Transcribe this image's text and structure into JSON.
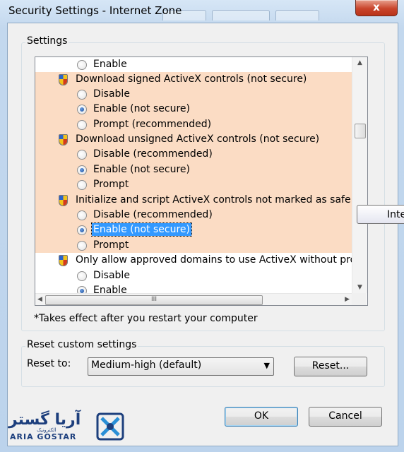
{
  "window": {
    "title": "Security Settings - Internet Zone",
    "close_glyph": "x"
  },
  "settings_group": {
    "label": "Settings",
    "items": [
      {
        "kind": "option",
        "label": "Enable",
        "checked": false
      },
      {
        "kind": "header",
        "label": "Download signed ActiveX controls (not secure)",
        "icon": "security-shield-icon"
      },
      {
        "kind": "option",
        "label": "Disable",
        "checked": false
      },
      {
        "kind": "option",
        "label": "Enable (not secure)",
        "checked": true
      },
      {
        "kind": "option",
        "label": "Prompt (recommended)",
        "checked": false
      },
      {
        "kind": "header",
        "label": "Download unsigned ActiveX controls (not secure)",
        "icon": "security-shield-icon"
      },
      {
        "kind": "option",
        "label": "Disable (recommended)",
        "checked": false
      },
      {
        "kind": "option",
        "label": "Enable (not secure)",
        "checked": true
      },
      {
        "kind": "option",
        "label": "Prompt",
        "checked": false
      },
      {
        "kind": "header",
        "label": "Initialize and script ActiveX controls not marked as safe for sc",
        "icon": "security-shield-icon"
      },
      {
        "kind": "option",
        "label": "Disable (recommended)",
        "checked": false
      },
      {
        "kind": "option",
        "label": "Enable (not secure)",
        "checked": true,
        "selected": true
      },
      {
        "kind": "option",
        "label": "Prompt",
        "checked": false
      },
      {
        "kind": "header",
        "label": "Only allow approved domains to use ActiveX without prompt",
        "icon": "security-shield-icon"
      },
      {
        "kind": "option",
        "label": "Disable",
        "checked": false
      },
      {
        "kind": "option",
        "label": "Enable",
        "checked": true
      }
    ],
    "note": "*Takes effect after you restart your computer",
    "hscroll_grip": "III"
  },
  "tooltip": {
    "text": "Inte"
  },
  "reset_group": {
    "label": "Reset custom settings",
    "reset_to_label": "Reset to:",
    "selected_value": "Medium-high (default)",
    "reset_button": "Reset..."
  },
  "buttons": {
    "ok": "OK",
    "cancel": "Cancel"
  },
  "watermark": {
    "name_fa": "آریا گستر",
    "sub_fa": "الکترونیک",
    "name_en": "ARIA GOSTAR"
  },
  "colors": {
    "highlight_rows": "#fbdcc4",
    "selection": "#3399ff",
    "close_button": "#c9452c"
  }
}
